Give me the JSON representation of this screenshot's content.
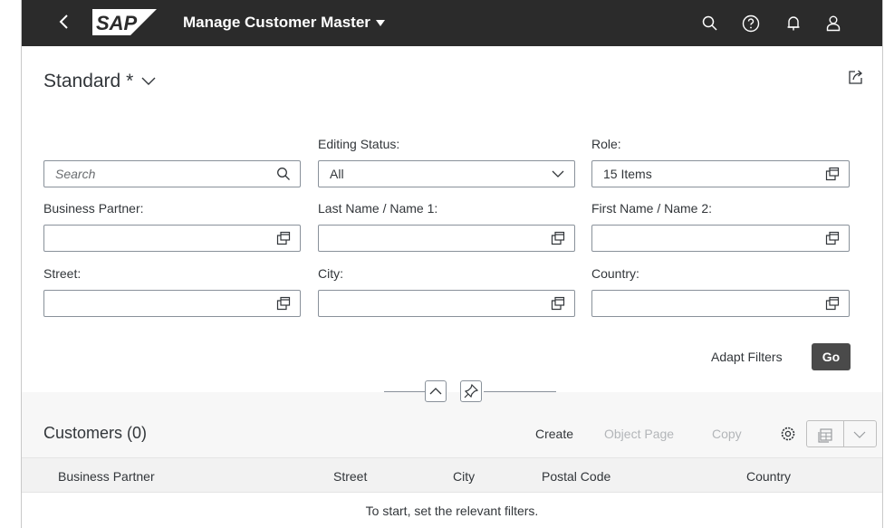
{
  "shell": {
    "logo_text": "SAP",
    "app_title": "Manage Customer Master",
    "icons": [
      "back-icon",
      "search-icon",
      "help-icon",
      "notification-icon",
      "user-icon"
    ],
    "bar_color": "#2b2b2b"
  },
  "header": {
    "variant": "Standard *",
    "share_icon": "share-icon"
  },
  "filters": {
    "search": {
      "placeholder": "Search"
    },
    "editing_status": {
      "label": "Editing Status:",
      "value": "All"
    },
    "role": {
      "label": "Role:",
      "value": "15 Items"
    },
    "business_partner": {
      "label": "Business Partner:",
      "value": ""
    },
    "last_name": {
      "label": "Last Name / Name 1:",
      "value": ""
    },
    "first_name": {
      "label": "First Name / Name 2:",
      "value": ""
    },
    "street": {
      "label": "Street:",
      "value": ""
    },
    "city": {
      "label": "City:",
      "value": ""
    },
    "country": {
      "label": "Country:",
      "value": ""
    },
    "adapt_filters": "Adapt Filters",
    "go": "Go"
  },
  "table": {
    "title": "Customers (0)",
    "toolbar": {
      "create": "Create",
      "object_page": "Object Page",
      "copy": "Copy"
    },
    "columns": [
      "Business Partner",
      "Street",
      "City",
      "Postal Code",
      "Country"
    ],
    "no_data": "To start, set the relevant filters."
  }
}
